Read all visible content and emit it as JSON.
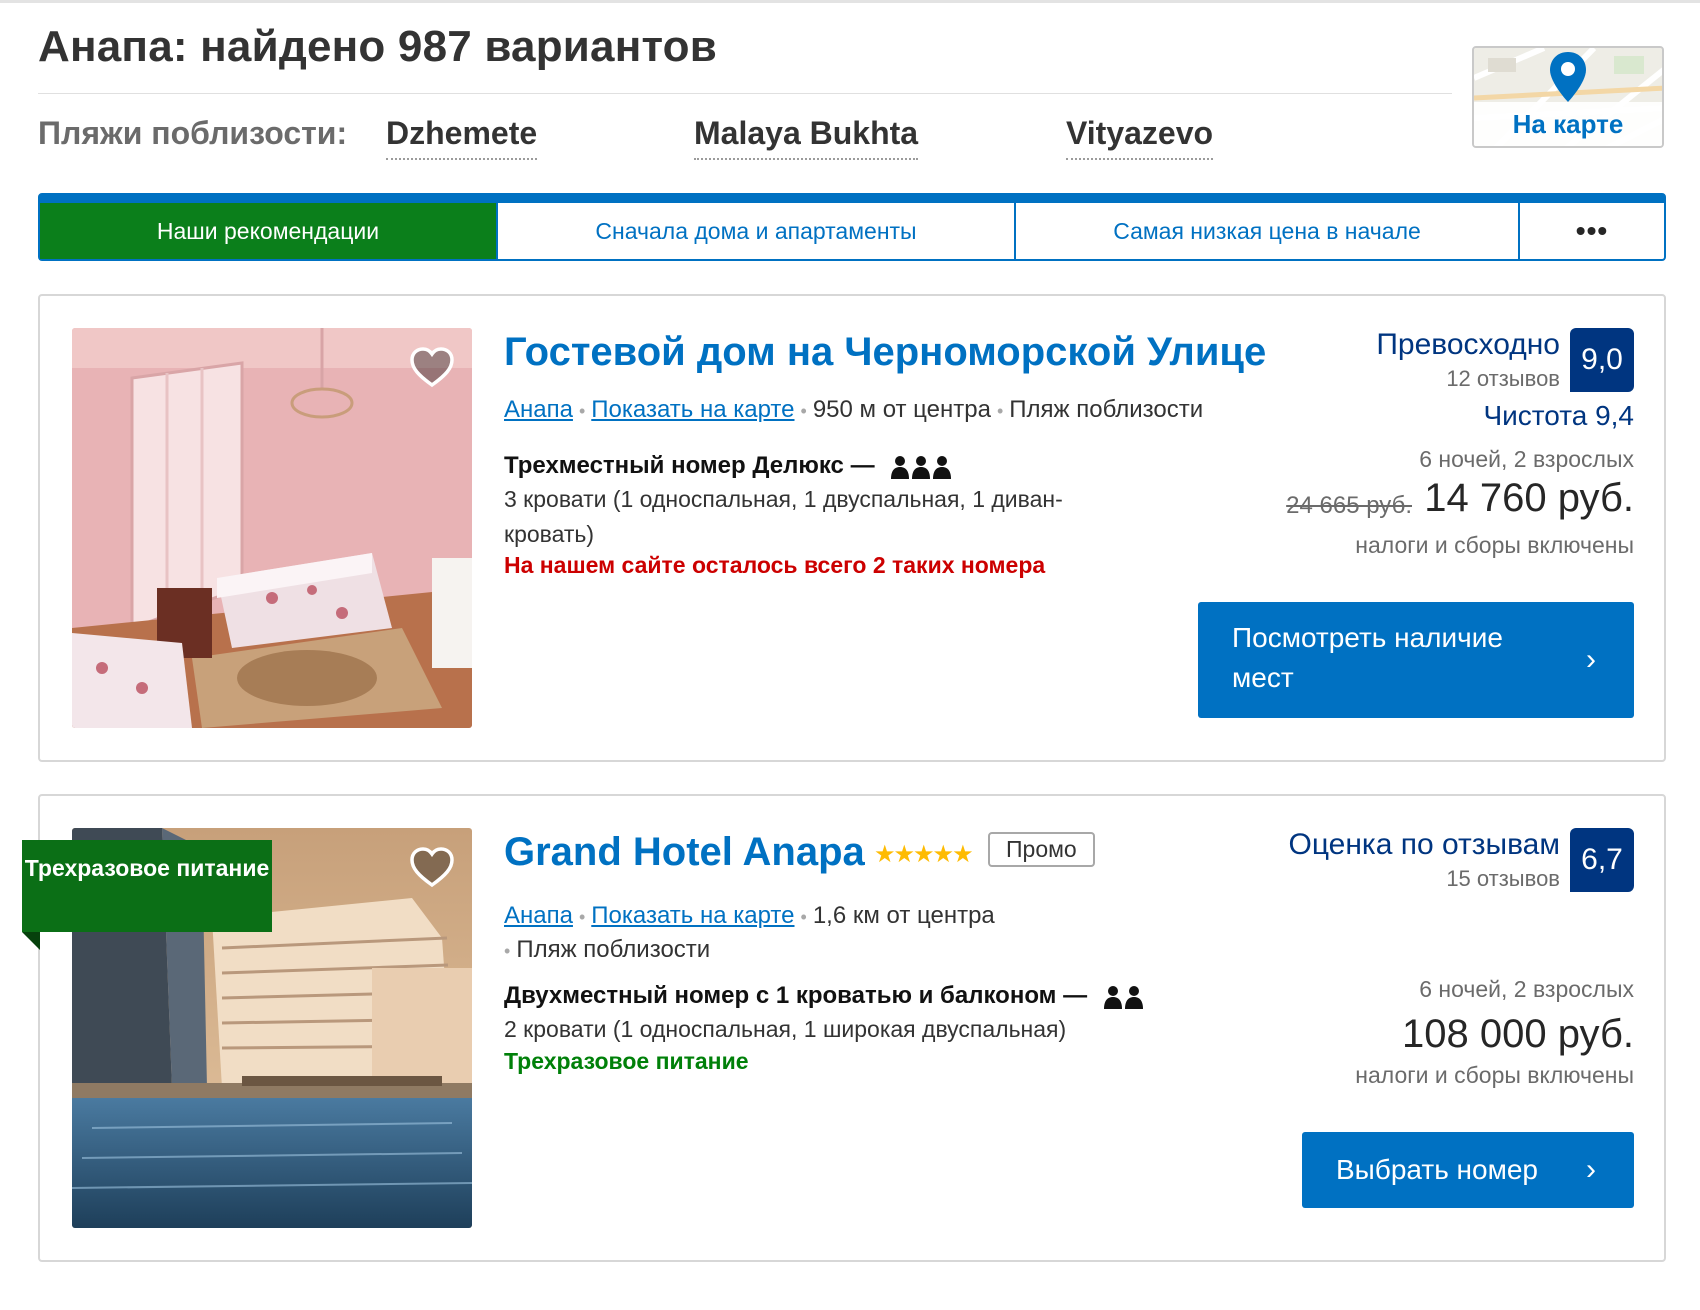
{
  "header": {
    "title": "Анапа: найдено 987 вариантов",
    "beaches_label": "Пляжи поблизости:",
    "beaches": [
      "Dzhemete",
      "Malaya Bukhta",
      "Vityazevo"
    ],
    "map_button_label": "На карте"
  },
  "sort_tabs": [
    {
      "label": "Наши рекомендации",
      "active": true
    },
    {
      "label": "Сначала дома и апартаменты",
      "active": false
    },
    {
      "label": "Самая низкая цена в начале",
      "active": false
    },
    {
      "label": "•••",
      "active": false
    }
  ],
  "listings": [
    {
      "name": "Гостевой дом на Черноморской Улице",
      "city_link": "Анапа",
      "map_link": "Показать на карте",
      "distance": "950 м от центра",
      "beach_note": "Пляж поблизости",
      "room_title": "Трехместный номер Делюкс",
      "dash": "—",
      "occupancy": 3,
      "beds": "3 кровати (1 односпальная, 1 двуспальная, 1 диван-кровать)",
      "urgency": "На нашем сайте осталось всего 2 таких номера",
      "score_word": "Превосходно",
      "reviews": "12 отзывов",
      "score": "9,0",
      "cleanliness": "Чистота 9,4",
      "stay": "6 ночей, 2 взрослых",
      "old_price": "24 665 руб.",
      "price": "14 760 руб.",
      "taxes": "налоги и сборы включены",
      "cta": "Посмотреть наличие мест"
    },
    {
      "name": "Grand Hotel Anapa",
      "stars": "★★★★★",
      "star_count": 5,
      "promo": "Промо",
      "ribbon": "Трехразовое питание",
      "city_link": "Анапа",
      "map_link": "Показать на карте",
      "distance": "1,6 км от центра",
      "beach_note": "Пляж поблизости",
      "room_title": "Двухместный номер с 1 кроватью и балконом",
      "dash": "—",
      "occupancy": 2,
      "beds": "2 кровати (1 односпальная, 1 широкая двуспальная)",
      "meal_note": "Трехразовое питание",
      "score_word": "Оценка по отзывам",
      "reviews": "15 отзывов",
      "score": "6,7",
      "stay": "6 ночей, 2 взрослых",
      "price": "108 000 руб.",
      "taxes": "налоги и сборы включены",
      "cta": "Выбрать номер"
    }
  ],
  "icons": {
    "chevron": "›",
    "heart": "heart-outline-icon",
    "pin": "map-pin-icon",
    "person": "person-icon"
  },
  "colors": {
    "link_blue": "#0071c2",
    "brand_dark_blue": "#003580",
    "green_active": "#0b7f1b",
    "urgency_red": "#cc0000",
    "star_yellow": "#febb02"
  }
}
